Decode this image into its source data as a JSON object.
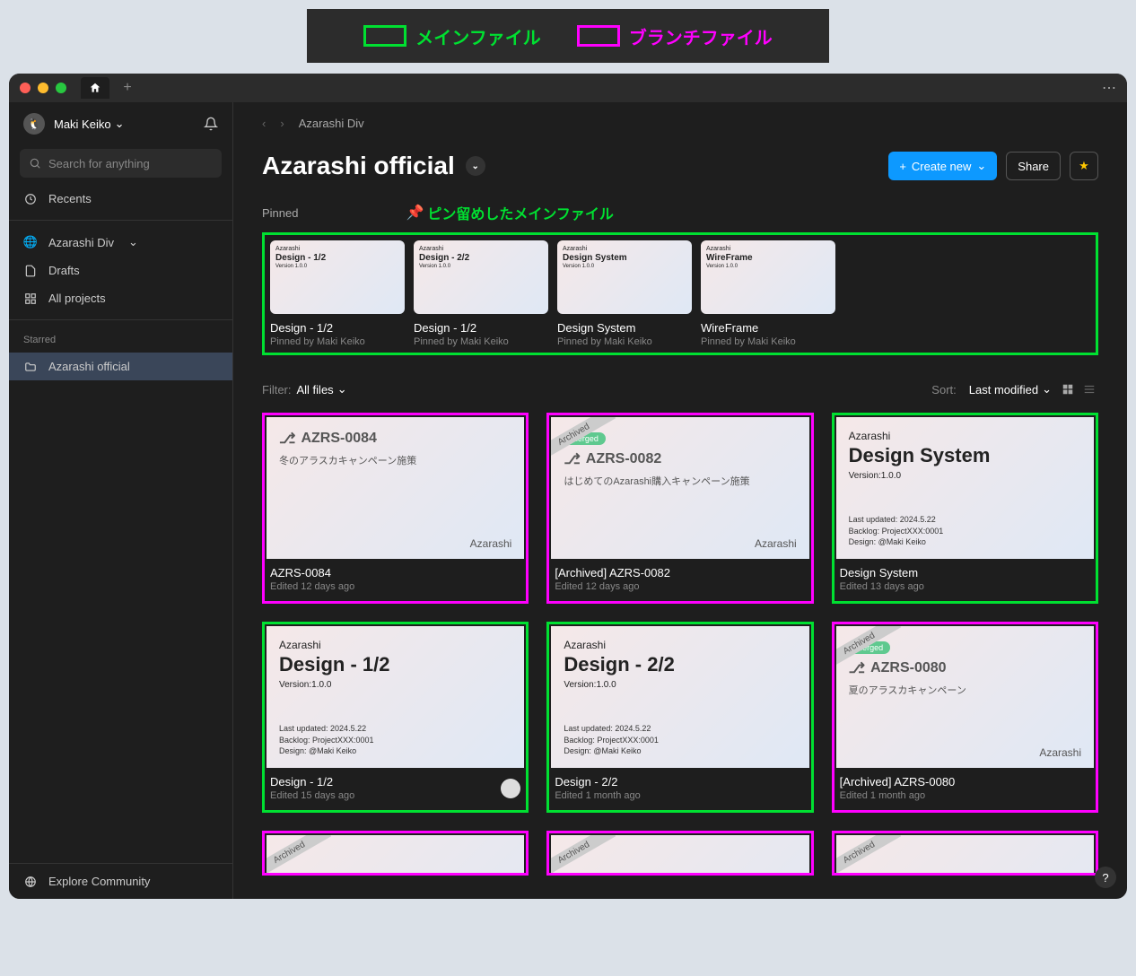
{
  "legend": {
    "main_file": "メインファイル",
    "branch_file": "ブランチファイル"
  },
  "user": {
    "name": "Maki Keiko"
  },
  "search": {
    "placeholder": "Search for anything"
  },
  "nav": {
    "recents": "Recents",
    "drafts": "Drafts",
    "all_projects": "All projects",
    "explore": "Explore Community"
  },
  "team": {
    "name": "Azarashi Div"
  },
  "starred_label": "Starred",
  "starred_items": [
    "Azarashi official"
  ],
  "breadcrumb": "Azarashi Div",
  "page_title": "Azarashi official",
  "actions": {
    "create_new": "Create new",
    "share": "Share"
  },
  "pinned": {
    "label": "Pinned",
    "annotation": "ピン留めしたメインファイル",
    "items": [
      {
        "title": "Design - 1/2",
        "sub": "Pinned by Maki Keiko",
        "thumb_brand": "Azarashi",
        "thumb_title": "Design - 1/2",
        "thumb_ver": "Version 1.0.0"
      },
      {
        "title": "Design - 1/2",
        "sub": "Pinned by Maki Keiko",
        "thumb_brand": "Azarashi",
        "thumb_title": "Design - 2/2",
        "thumb_ver": "Version 1.0.0"
      },
      {
        "title": "Design System",
        "sub": "Pinned by Maki Keiko",
        "thumb_brand": "Azarashi",
        "thumb_title": "Design System",
        "thumb_ver": "Version 1.0.0"
      },
      {
        "title": "WireFrame",
        "sub": "Pinned by Maki Keiko",
        "thumb_brand": "Azarashi",
        "thumb_title": "WireFrame",
        "thumb_ver": "Version 1.0.0"
      }
    ]
  },
  "filter": {
    "label": "Filter:",
    "value": "All files"
  },
  "sort": {
    "label": "Sort:",
    "value": "Last modified"
  },
  "files": [
    {
      "type": "branch",
      "title": "AZRS-0084",
      "edited": "Edited 12 days ago",
      "thumb": {
        "azrs": "AZRS-0084",
        "sub": "冬のアラスカキャンペーン施策",
        "brand": "Azarashi"
      }
    },
    {
      "type": "branch",
      "title": "[Archived] AZRS-0082",
      "edited": "Edited 12 days ago",
      "thumb": {
        "archived": true,
        "merged": "merged",
        "azrs": "AZRS-0082",
        "sub": "はじめてのAzarashi購入キャンペーン施策",
        "brand": "Azarashi"
      }
    },
    {
      "type": "main",
      "title": "Design System",
      "edited": "Edited 13 days ago",
      "thumb": {
        "brand": "Azarashi",
        "big_title": "Design System",
        "ver": "Version:1.0.0",
        "meta": "Last updated: 2024.5.22\nBacklog: ProjectXXX:0001\nDesign: @Maki Keiko"
      }
    },
    {
      "type": "main",
      "title": "Design - 1/2",
      "edited": "Edited 15 days ago",
      "avatar": true,
      "thumb": {
        "brand": "Azarashi",
        "big_title": "Design - 1/2",
        "ver": "Version:1.0.0",
        "meta": "Last updated: 2024.5.22\nBacklog: ProjectXXX:0001\nDesign: @Maki Keiko"
      }
    },
    {
      "type": "main",
      "title": "Design - 2/2",
      "edited": "Edited 1 month ago",
      "thumb": {
        "brand": "Azarashi",
        "big_title": "Design - 2/2",
        "ver": "Version:1.0.0",
        "meta": "Last updated: 2024.5.22\nBacklog: ProjectXXX:0001\nDesign: @Maki Keiko"
      }
    },
    {
      "type": "branch",
      "title": "[Archived] AZRS-0080",
      "edited": "Edited 1 month ago",
      "thumb": {
        "archived": true,
        "merged": "merged",
        "azrs": "AZRS-0080",
        "sub": "夏のアラスカキャンペーン",
        "brand": "Azarashi"
      }
    },
    {
      "type": "branch",
      "title": "",
      "edited": "",
      "thumb": {
        "archived": true
      }
    },
    {
      "type": "branch",
      "title": "",
      "edited": "",
      "thumb": {
        "archived": true
      }
    },
    {
      "type": "branch",
      "title": "",
      "edited": "",
      "thumb": {
        "archived": true
      }
    }
  ]
}
